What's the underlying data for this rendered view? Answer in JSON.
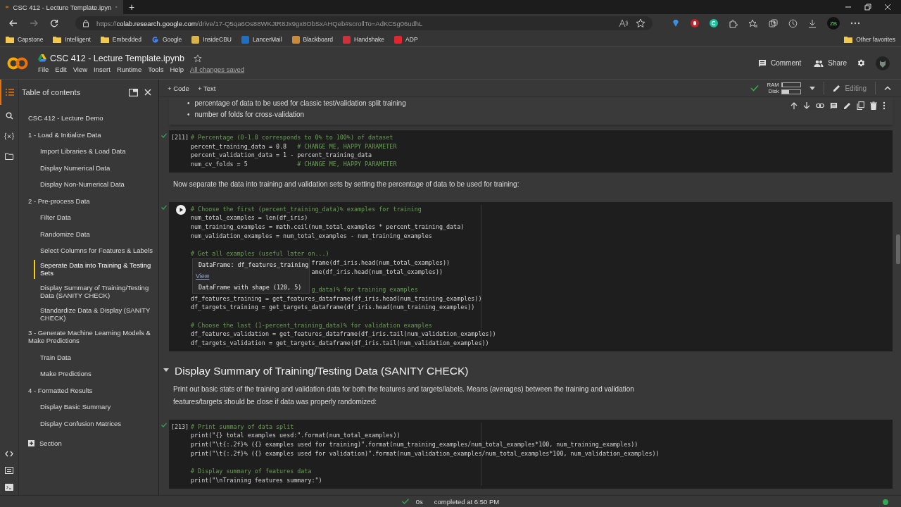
{
  "browser": {
    "tab": {
      "title": "CSC 412 - Lecture Template.ipyn"
    },
    "new_tab": "+",
    "url": {
      "scheme": "https://",
      "host": "colab.research.google.com",
      "path": "/drive/17-Q5qa6Os88WKJtR8Jx9gx8ObSxAHQeb#scrollTo=AdKC5g06udhL"
    },
    "profile": "ZB",
    "bookmarks": [
      {
        "label": "Capstone",
        "kind": "folder"
      },
      {
        "label": "Intelligent",
        "kind": "folder"
      },
      {
        "label": "Embedded",
        "kind": "folder"
      },
      {
        "label": "Google",
        "kind": "google"
      },
      {
        "label": "InsideCBU",
        "kind": "site",
        "color": "#d8b24a"
      },
      {
        "label": "LancerMail",
        "kind": "site",
        "color": "#1f6fc4"
      },
      {
        "label": "Blackboard",
        "kind": "site",
        "color": "#c98a3a"
      },
      {
        "label": "Handshake",
        "kind": "site",
        "color": "#d0303a"
      },
      {
        "label": "ADP",
        "kind": "site",
        "color": "#e0262e"
      }
    ],
    "other_favorites": "Other favorites"
  },
  "notebook": {
    "title": "CSC 412 - Lecture Template.ipynb",
    "menu": [
      "File",
      "Edit",
      "View",
      "Insert",
      "Runtime",
      "Tools",
      "Help"
    ],
    "save_status": "All changes saved",
    "comment": "Comment",
    "share": "Share"
  },
  "toolbar": {
    "add_code": "+ Code",
    "add_text": "+ Text",
    "connected": true,
    "ram_label": "RAM",
    "disk_label": "Disk",
    "ram": {
      "level": 0.04
    },
    "disk": {
      "level": 0.35
    },
    "mode": "Editing"
  },
  "sidebar": {
    "title": "Table of contents",
    "items": [
      {
        "label": "CSC 412 - Lecture Demo",
        "selected": false
      },
      {
        "label": "1 - Load & Initialize Data",
        "selected": false,
        "children": [
          {
            "label": "Import Libraries & Load Data",
            "selected": false
          },
          {
            "label": "Display Numerical Data",
            "selected": false
          },
          {
            "label": "Display Non-Numerical Data",
            "selected": false
          }
        ]
      },
      {
        "label": "2 - Pre-process Data",
        "selected": false,
        "children": [
          {
            "label": "Filter Data",
            "selected": false
          },
          {
            "label": "Randomize Data",
            "selected": false
          },
          {
            "label": "Select Columns for Features & Labels",
            "selected": false
          },
          {
            "label": "Seperate Data into Training & Testing Sets",
            "selected": true
          },
          {
            "label": "Display Summary of Training/Testing Data (SANITY CHECK)",
            "selected": false
          },
          {
            "label": "Standardize Data & Display (SANITY CHECK)",
            "selected": false
          }
        ]
      },
      {
        "label": "3 - Generate Machine Learning Models & Make Predictions",
        "selected": false,
        "children": [
          {
            "label": "Train Data",
            "selected": false
          },
          {
            "label": "Make Predictions",
            "selected": false
          }
        ]
      },
      {
        "label": "4 - Formatted Results",
        "selected": false,
        "children": [
          {
            "label": "Display Basic Summary",
            "selected": false
          },
          {
            "label": "Display Confusion Matrices",
            "selected": false
          }
        ]
      }
    ],
    "add_section": "Section"
  },
  "cells": [
    {
      "kind": "text",
      "selected": true,
      "bullets": [
        {
          "marker": "•",
          "text": "percentage of data to be used for classic test/validation split training"
        },
        {
          "marker": "•",
          "text": "number of folds for cross-validation"
        }
      ]
    },
    {
      "kind": "code",
      "executed": true,
      "count": "[211]",
      "ruler": false,
      "blocks": [
        [
          {
            "comment": "# Percentage (0-1.0 corresponds to 0% to 100%) of dataset"
          },
          {
            "code": "percent_training_data = 0.8   ",
            "comment": "# CHANGE ME, HAPPY PARAMETER"
          },
          {
            "code": "percent_validation_data = 1 - percent_training_data"
          },
          {
            "code": "num_cv_folds = 5              ",
            "comment": "# CHANGE ME, HAPPY PARAMETER"
          }
        ]
      ]
    },
    {
      "kind": "text",
      "paragraph": "Now separate the data into training and validation sets by setting the percentage of data to be used for training:"
    },
    {
      "kind": "code",
      "executed": true,
      "ruler": true,
      "blocks": [
        [
          {
            "comment": "# Choose the first (percent_training_data)% examples for training"
          },
          {
            "code": "num_total_examples = len(df_iris)"
          },
          {
            "code": "num_training_examples = math.ceil(num_total_examples * percent_training_data)"
          },
          {
            "code": "num_validation_examples = num_total_examples - num_training_examples"
          }
        ],
        [
          {
            "comment": "# Get all examples (useful later on...)"
          },
          {
            "code": "frame(df_iris.head(num_total_examples))",
            "covered": true
          },
          {
            "code": "ame(df_iris.head(num_total_examples))",
            "covered": true
          }
        ],
        [
          {
            "comment": "g_data)% for training examples",
            "covered": true
          },
          {
            "code": "df_features_training = get_features_dataframe(df_iris.head(num_training_examples))"
          },
          {
            "code": "df_targets_training = get_targets_dataframe(df_iris.head(num_training_examples))"
          }
        ],
        [
          {
            "comment": "# Choose the last (1-percent_training_data)% for validation examples"
          },
          {
            "code": "df_features_validation = get_features_dataframe(df_iris.tail(num_validation_examples))"
          },
          {
            "code": "df_targets_validation = get_targets_dataframe(df_iris.tail(num_validation_examples))"
          }
        ]
      ],
      "tooltip": {
        "title": "DataFrame: df_features_training",
        "link": "View",
        "detail": "DataFrame with shape (120, 5)"
      }
    },
    {
      "kind": "heading",
      "expanded": true,
      "text": "Display Summary of Training/Testing Data (SANITY CHECK)"
    },
    {
      "kind": "text",
      "paragraph": "Print out basic stats of the training and validation data for both the features and targets/labels. Means (averages) between the training and validation features/targets should be close if data was properly randomized:"
    },
    {
      "kind": "code",
      "executed": true,
      "count": "[213]",
      "ruler": true,
      "blocks": [
        [
          {
            "comment": "# Print summary of data split"
          },
          {
            "code": "print(\"{} total examples uesd:\".format(num_total_examples))"
          },
          {
            "code": "print(\"\\t{:.2f}% ({} examples used for training)\".format(num_training_examples/num_total_examples*100, num_training_examples))"
          },
          {
            "code": "print(\"\\t{:.2f}% ({} examples used for validation)\".format(num_validation_examples/num_total_examples*100, num_validation_examples))"
          }
        ],
        [
          {
            "comment": "# Display summary of features data"
          },
          {
            "code": "print(\"\\nTraining features summary:\")"
          }
        ]
      ]
    }
  ],
  "status_bar": {
    "done": true,
    "duration": "0s",
    "message": "completed at 6:50 PM"
  }
}
